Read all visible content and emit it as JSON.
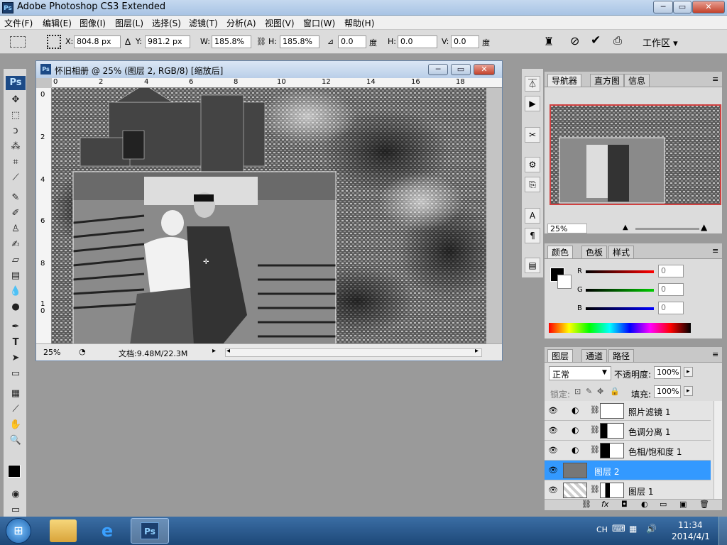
{
  "app": {
    "title": "Adobe Photoshop CS3 Extended",
    "logo": "Ps"
  },
  "window_controls": {
    "minimize": "─",
    "maximize": "▭",
    "close": "✕"
  },
  "menu": [
    "文件(F)",
    "编辑(E)",
    "图像(I)",
    "图层(L)",
    "选择(S)",
    "滤镜(T)",
    "分析(A)",
    "视图(V)",
    "窗口(W)",
    "帮助(H)"
  ],
  "options": {
    "x_label": "X:",
    "x_value": "804.8 px",
    "y_label": "Y:",
    "y_value": "981.2 px",
    "w_label": "W:",
    "w_value": "185.8%",
    "h_label": "H:",
    "h_value": "185.8%",
    "angle_value": "0.0",
    "angle_unit": "度",
    "hskew_label": "H:",
    "hskew_value": "0.0",
    "hskew_unit": "度",
    "vskew_label": "V:",
    "vskew_value": "0.0",
    "vskew_unit": "度",
    "workspace": "工作区 ▾"
  },
  "document": {
    "title": "怀旧相册 @ 25% (图层 2, RGB/8) [缩放后]",
    "zoom": "25%",
    "doc_info": "文档:9.48M/22.3M",
    "ruler_h": [
      "0",
      "2",
      "4",
      "6",
      "8",
      "10",
      "12",
      "14",
      "16",
      "18"
    ],
    "ruler_v": [
      "0",
      "2",
      "4",
      "6",
      "8",
      "1\n0"
    ]
  },
  "navigator": {
    "tabs": [
      "导航器",
      "直方图",
      "信息"
    ],
    "zoom": "25%"
  },
  "color": {
    "tabs": [
      "颜色",
      "色板",
      "样式"
    ],
    "r_label": "R",
    "g_label": "G",
    "b_label": "B",
    "r": "0",
    "g": "0",
    "b": "0"
  },
  "layers": {
    "tabs": [
      "图层",
      "通道",
      "路径"
    ],
    "blend": "正常",
    "opacity_label": "不透明度:",
    "opacity": "100%",
    "lock_label": "锁定:",
    "fill_label": "填充:",
    "fill": "100%",
    "items": [
      {
        "name": "照片滤镜 1",
        "selected": false
      },
      {
        "name": "色调分离 1",
        "selected": false
      },
      {
        "name": "色相/饱和度 1",
        "selected": false
      },
      {
        "name": "图层 2",
        "selected": true
      },
      {
        "name": "图层 1",
        "selected": false
      }
    ]
  },
  "taskbar": {
    "lang": "CH",
    "time": "11:34",
    "date": "2014/4/1",
    "ps_label": "Ps"
  }
}
